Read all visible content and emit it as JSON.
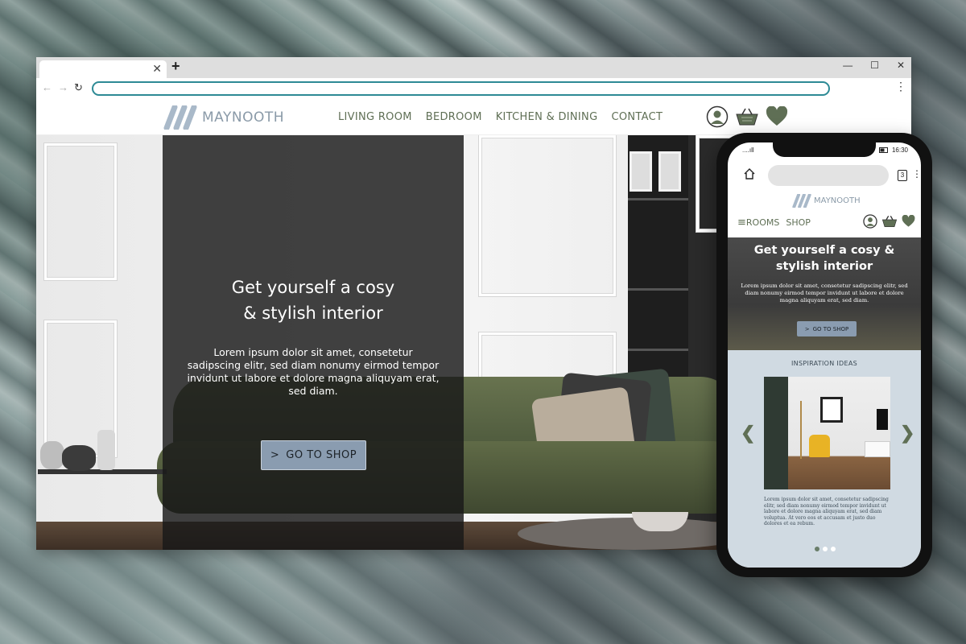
{
  "desktop": {
    "tab": {
      "close_glyph": "✕"
    },
    "new_tab_glyph": "+",
    "window_controls": {
      "minimize": "—",
      "maximize": "☐",
      "close": "✕"
    },
    "nav_buttons": {
      "back": "←",
      "forward": "→",
      "reload": "↻"
    },
    "menu_glyph": "⋮",
    "brand": "MAYNOOTH",
    "nav": [
      "LIVING ROOM",
      "BEDROOM",
      "KITCHEN & DINING",
      "CONTACT"
    ],
    "icons": [
      "user-icon",
      "basket-icon",
      "heart-icon"
    ],
    "hero": {
      "title_line1": "Get yourself a cosy",
      "title_line2": "& stylish interior",
      "text": "Lorem ipsum dolor sit amet, consetetur sadipscing elitr, sed diam nonumy eirmod tempor invidunt ut labore et dolore magna aliquyam erat, sed diam.",
      "button_arrow": ">",
      "button_label": "GO TO SHOP"
    }
  },
  "mobile": {
    "status": {
      "signal": "....ıll",
      "time": "16:30"
    },
    "tab_count": "3",
    "brand": "MAYNOOTH",
    "nav": {
      "menu_glyph": "≡",
      "rooms": "ROOMS",
      "shop": "SHOP"
    },
    "hero": {
      "title_line1": "Get yourself a cosy &",
      "title_line2": "stylish interior",
      "text": "Lorem ipsum dolor sit amet, consetetur sadipscing elitr, sed diam nonumy eirmod tempor invidunt ut labore et dolore magna aliquyam erat, sed diam.",
      "button_arrow": ">",
      "button_label": "GO TO SHOP"
    },
    "inspiration": {
      "title": "INSPIRATION IDEAS",
      "prev_glyph": "❮",
      "next_glyph": "❯",
      "text": "Lorem ipsum dolor sit amet, consetetur sadipscing elitr, sed diam nonumy eirmod tempor invidunt ut labore et dolore magna aliquyam erat, sed diam voluptua. At vero eos et accusam et justo duo dolores et ea rebum.",
      "active_slide": 1,
      "slide_count": 3
    }
  },
  "colors": {
    "brand_green": "#5f6f55",
    "brand_blue": "#8a9cb0",
    "url_border": "#2d8a95",
    "inspiration_bg": "#d0dae2"
  }
}
